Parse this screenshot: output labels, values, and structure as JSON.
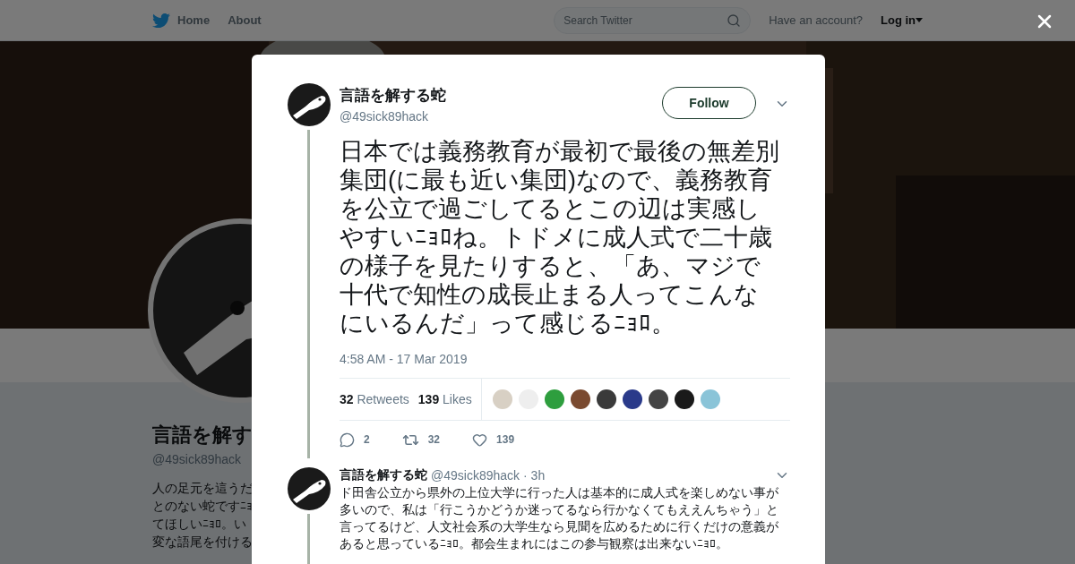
{
  "nav": {
    "links": [
      {
        "label": "Home"
      },
      {
        "label": "About"
      }
    ],
    "search": {
      "placeholder": "Search Twitter"
    },
    "account_prompt": "Have an account?",
    "login": "Log in"
  },
  "profile": {
    "name": "言語を解す",
    "handle": "@49sick89hack",
    "bio_lines": [
      "人の足元を這うだ",
      "とのない蛇ですﾆｮ",
      "てほしいﾆｮﾛ。い",
      "変な語尾を付ける"
    ]
  },
  "tweet": {
    "name": "言語を解する蛇",
    "handle": "@49sick89hack",
    "follow": "Follow",
    "text": "日本では義務教育が最初で最後の無差別集団(に最も近い集団)なので、義務教育を公立で過ごしてるとこの辺は実感しやすいﾆｮﾛね。トドメに成人式で二十歳の様子を見たりすると、「あ、マジで十代で知性の成長止まる人ってこんなにいるんだ」って感じるﾆｮﾛ。",
    "timestamp": "4:58 AM - 17 Mar 2019",
    "retweets": {
      "count": "32",
      "label": "Retweets"
    },
    "likes": {
      "count": "139",
      "label": "Likes"
    },
    "likers": [
      {
        "color": "#d8d0c4"
      },
      {
        "color": "#eeeeee"
      },
      {
        "color": "#2e9e3e"
      },
      {
        "color": "#7a4a30"
      },
      {
        "color": "#3a3a3a"
      },
      {
        "color": "#2a3a8a"
      },
      {
        "color": "#444444"
      },
      {
        "color": "#1a1a1a"
      },
      {
        "color": "#8ac4d8"
      }
    ],
    "actions": {
      "replies": "2",
      "retweets": "32",
      "likes": "139"
    }
  },
  "reply": {
    "name": "言語を解する蛇",
    "handle": "@49sick89hack",
    "time": "· 3h",
    "text": "ド田舎公立から県外の上位大学に行った人は基本的に成人式を楽しめない事が多いので、私は「行こうかどうか迷ってるなら行かなくてもええんちゃう」と言ってるけど、人文社会系の大学生なら見聞を広めるために行くだけの意義があると思っているﾆｮﾛ。都会生まれにはこの参与観察は出来ないﾆｮﾛ。"
  }
}
